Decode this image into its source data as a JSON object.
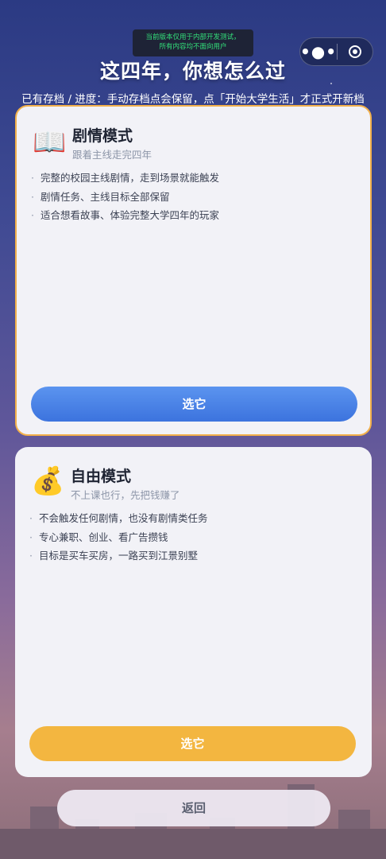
{
  "dev_banner": {
    "line1": "当前版本仅用于内部开发测试，",
    "line2": "所有内容均不面向用户"
  },
  "capsule": {
    "more_icon": "more-dots-icon",
    "close_icon": "target-circle-icon"
  },
  "header": {
    "title": "这四年，你想怎么过",
    "subtitle": "已有存档 / 进度：手动存档点会保留，点「开始大学生活」才正式开新档"
  },
  "modes": [
    {
      "icon": "📖",
      "icon_name": "open-book-icon",
      "name": "剧情模式",
      "tagline": "跟着主线走完四年",
      "features": [
        "完整的校园主线剧情，走到场景就能触发",
        "剧情任务、主线目标全部保留",
        "适合想看故事、体验完整大学四年的玩家"
      ],
      "button": "选它"
    },
    {
      "icon": "💰",
      "icon_name": "money-bag-icon",
      "name": "自由模式",
      "tagline": "不上课也行，先把钱赚了",
      "features": [
        "不会触发任何剧情，也没有剧情类任务",
        "专心兼职、创业、看广告攒钱",
        "目标是买车买房，一路买到江景别墅"
      ],
      "button": "选它"
    }
  ],
  "back_button": "返回",
  "colors": {
    "story_border": "#f2b04a",
    "story_button": "#4a82e6",
    "free_button": "#f3b640",
    "card_bg": "#f2f2f7"
  }
}
